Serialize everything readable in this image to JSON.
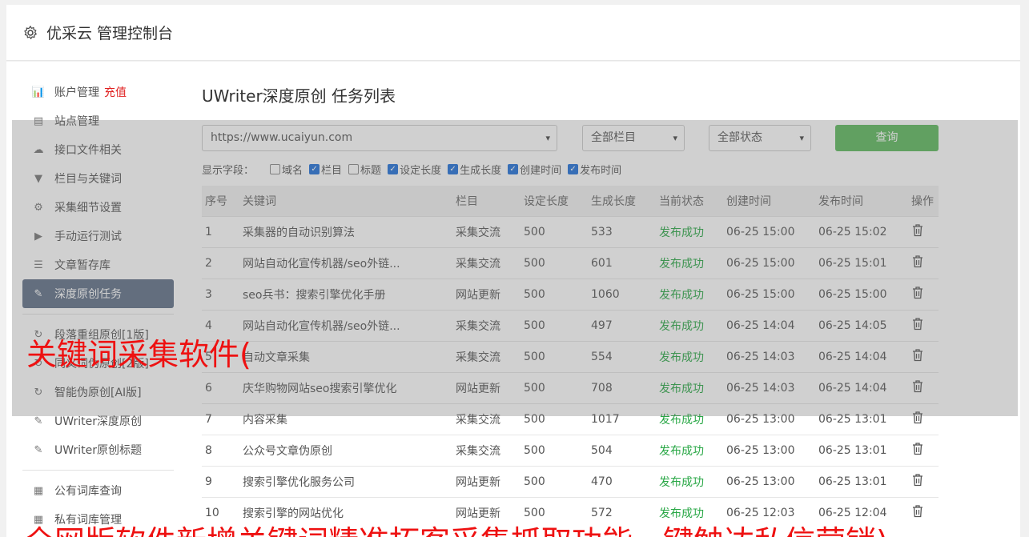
{
  "header": {
    "title": "优采云 管理控制台",
    "icon": "gear-icon"
  },
  "sidebar": {
    "group1": [
      {
        "label": "账户管理",
        "extra": "充值",
        "icon": "bar-chart-icon"
      },
      {
        "label": "站点管理",
        "icon": "server-icon"
      },
      {
        "label": "接口文件相关",
        "icon": "cloud-upload-icon"
      },
      {
        "label": "栏目与关键词",
        "icon": "filter-icon"
      },
      {
        "label": "采集细节设置",
        "icon": "cogs-icon"
      },
      {
        "label": "手动运行测试",
        "icon": "play-circle-icon"
      },
      {
        "label": "文章暂存库",
        "icon": "database-icon"
      },
      {
        "label": "深度原创任务",
        "icon": "edit-icon",
        "active": true
      }
    ],
    "group2": [
      {
        "label": "段落重组原创[1版]",
        "icon": "refresh-icon"
      },
      {
        "label": "同义词伪原创[2版]",
        "icon": "refresh-icon"
      },
      {
        "label": "智能伪原创[AI版]",
        "icon": "refresh-icon"
      },
      {
        "label": "UWriter深度原创",
        "icon": "edit-icon"
      },
      {
        "label": "UWriter原创标题",
        "icon": "edit-icon"
      }
    ],
    "group3": [
      {
        "label": "公有词库查询",
        "icon": "book-icon"
      },
      {
        "label": "私有词库管理",
        "icon": "book-icon"
      }
    ]
  },
  "main": {
    "title": "UWriter深度原创 任务列表",
    "site_select": "https://www.ucaiyun.com",
    "column_select": "全部栏目",
    "status_select": "全部状态",
    "query_button": "查询",
    "fields_label": "显示字段：",
    "fields": [
      {
        "label": "域名",
        "checked": false
      },
      {
        "label": "栏目",
        "checked": true
      },
      {
        "label": "标题",
        "checked": false
      },
      {
        "label": "设定长度",
        "checked": true
      },
      {
        "label": "生成长度",
        "checked": true
      },
      {
        "label": "创建时间",
        "checked": true
      },
      {
        "label": "发布时间",
        "checked": true
      }
    ],
    "columns": [
      "序号",
      "关键词",
      "栏目",
      "设定长度",
      "生成长度",
      "当前状态",
      "创建时间",
      "发布时间",
      "操作"
    ],
    "rows": [
      [
        "1",
        "采集器的自动识别算法",
        "采集交流",
        "500",
        "533",
        "发布成功",
        "06-25 15:00",
        "06-25 15:02"
      ],
      [
        "2",
        "网站自动化宣传机器/seo外链...",
        "采集交流",
        "500",
        "601",
        "发布成功",
        "06-25 15:00",
        "06-25 15:01"
      ],
      [
        "3",
        "seo兵书：搜索引擎优化手册",
        "网站更新",
        "500",
        "1060",
        "发布成功",
        "06-25 15:00",
        "06-25 15:00"
      ],
      [
        "4",
        "网站自动化宣传机器/seo外链...",
        "采集交流",
        "500",
        "497",
        "发布成功",
        "06-25 14:04",
        "06-25 14:05"
      ],
      [
        "5",
        "自动文章采集",
        "采集交流",
        "500",
        "554",
        "发布成功",
        "06-25 14:03",
        "06-25 14:04"
      ],
      [
        "6",
        "庆华购物网站seo搜索引擎优化",
        "网站更新",
        "500",
        "708",
        "发布成功",
        "06-25 14:03",
        "06-25 14:04"
      ],
      [
        "7",
        "内容采集",
        "采集交流",
        "500",
        "1017",
        "发布成功",
        "06-25 13:00",
        "06-25 13:01"
      ],
      [
        "8",
        "公众号文章伪原创",
        "采集交流",
        "500",
        "504",
        "发布成功",
        "06-25 13:00",
        "06-25 13:01"
      ],
      [
        "9",
        "搜索引擎优化服务公司",
        "网站更新",
        "500",
        "470",
        "发布成功",
        "06-25 13:00",
        "06-25 13:01"
      ],
      [
        "10",
        "搜索引擎的网站优化",
        "网站更新",
        "500",
        "572",
        "发布成功",
        "06-25 12:03",
        "06-25 12:04"
      ]
    ],
    "status_color": "#28a745",
    "delete_icon": "trash-icon"
  },
  "watermarks": {
    "line1": "关键词采集软件(",
    "line2": "全网版软件新增关键词精准拓客采集抓取功能一键触达私信营销)"
  },
  "colors": {
    "active_bg": "#5f6f86",
    "query_button": "#5cb85c",
    "recharge": "#e02020",
    "watermark": "#ee1111"
  }
}
